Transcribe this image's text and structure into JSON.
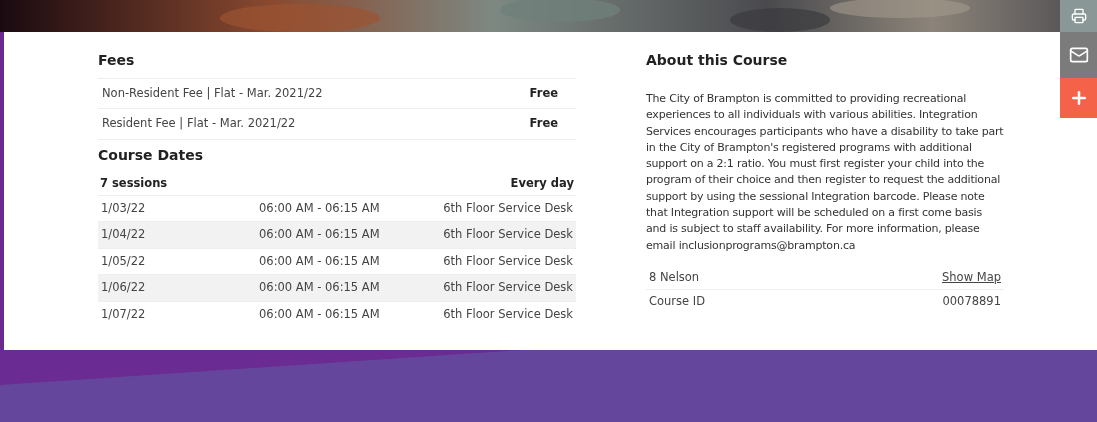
{
  "fees": {
    "title": "Fees",
    "rows": [
      {
        "name": "Non-Resident Fee | Flat - Mar. 2021/22",
        "price": "Free"
      },
      {
        "name": "Resident Fee | Flat - Mar. 2021/22",
        "price": "Free"
      }
    ]
  },
  "course_dates": {
    "title": "Course Dates",
    "sessions": "7 sessions",
    "frequency": "Every day",
    "rows": [
      {
        "date": "1/03/22",
        "time": "06:00 AM - 06:15 AM",
        "location": "6th Floor Service Desk"
      },
      {
        "date": "1/04/22",
        "time": "06:00 AM - 06:15 AM",
        "location": "6th Floor Service Desk"
      },
      {
        "date": "1/05/22",
        "time": "06:00 AM - 06:15 AM",
        "location": "6th Floor Service Desk"
      },
      {
        "date": "1/06/22",
        "time": "06:00 AM - 06:15 AM",
        "location": "6th Floor Service Desk"
      },
      {
        "date": "1/07/22",
        "time": "06:00 AM - 06:15 AM",
        "location": "6th Floor Service Desk"
      }
    ]
  },
  "about": {
    "title": "About this Course",
    "description": "The City of Brampton is committed to providing recreational experiences to all individuals with various abilities. Integration Services encourages participants who have a disability to take part in the City of Brampton's registered programs with additional support on a 2:1 ratio. You must first register your child into the program of their choice and then register to request the additional support by using the sessional Integration barcode. Please note that Integration support will be scheduled on a first come basis and is subject to staff availability.  For more information, please email inclusionprograms@brampton.ca",
    "location": "8 Nelson",
    "map_link": "Show Map",
    "course_id_label": "Course ID",
    "course_id": "00078891"
  },
  "side_buttons": [
    {
      "kind": "print"
    },
    {
      "kind": "mail"
    },
    {
      "kind": "add"
    }
  ]
}
